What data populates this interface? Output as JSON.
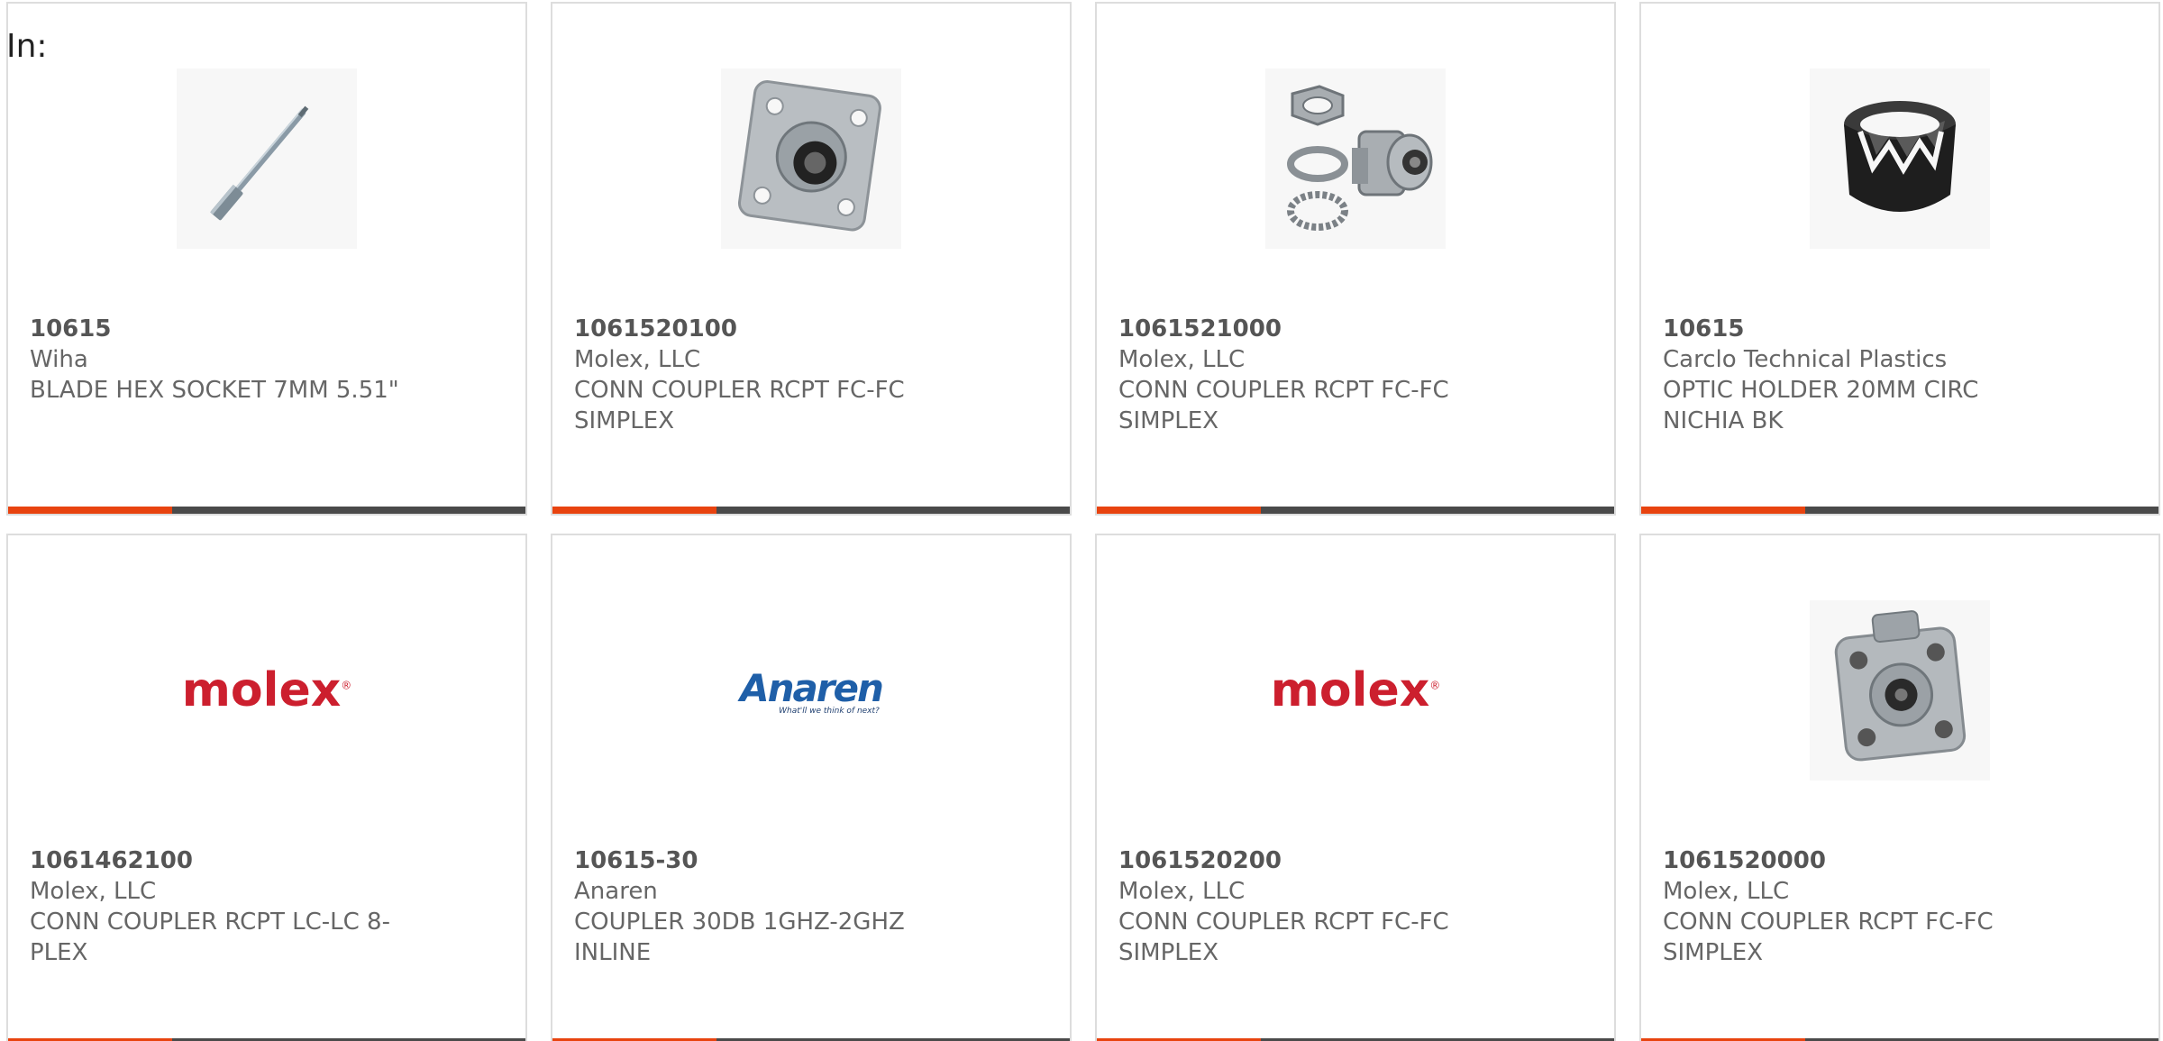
{
  "header": {
    "label": "In:"
  },
  "colors": {
    "accent": "#e8430f",
    "bar": "#4a4a4a",
    "molex_red": "#cc1f2e",
    "anaren_blue": "#1f5fa8"
  },
  "products": [
    {
      "part": "10615",
      "maker": "Wiha",
      "desc": "BLADE HEX SOCKET 7MM 5.51\"",
      "image": "hex-blade-image"
    },
    {
      "part": "1061520100",
      "maker": "Molex, LLC",
      "desc": "CONN COUPLER RCPT FC-FC SIMPLEX",
      "image": "square-flange-coupler-image"
    },
    {
      "part": "1061521000",
      "maker": "Molex, LLC",
      "desc": "CONN COUPLER RCPT FC-FC SIMPLEX",
      "image": "round-coupler-kit-image"
    },
    {
      "part": "10615",
      "maker": "Carclo Technical Plastics",
      "desc": "OPTIC HOLDER 20MM CIRC NICHIA BK",
      "image": "optic-holder-image"
    },
    {
      "part": "1061462100",
      "maker": "Molex, LLC",
      "desc": "CONN COUPLER RCPT LC-LC 8-PLEX",
      "image": "molex-logo",
      "logo_text": "molex"
    },
    {
      "part": "10615-30",
      "maker": "Anaren",
      "desc": "COUPLER 30DB 1GHZ-2GHZ INLINE",
      "image": "anaren-logo",
      "logo_text": "Anaren",
      "logo_tagline": "What'll we think of next?"
    },
    {
      "part": "1061520200",
      "maker": "Molex, LLC",
      "desc": "CONN COUPLER RCPT FC-FC SIMPLEX",
      "image": "molex-logo",
      "logo_text": "molex"
    },
    {
      "part": "1061520000",
      "maker": "Molex, LLC",
      "desc": "CONN COUPLER RCPT FC-FC SIMPLEX",
      "image": "square-flange-coupler-image"
    }
  ]
}
